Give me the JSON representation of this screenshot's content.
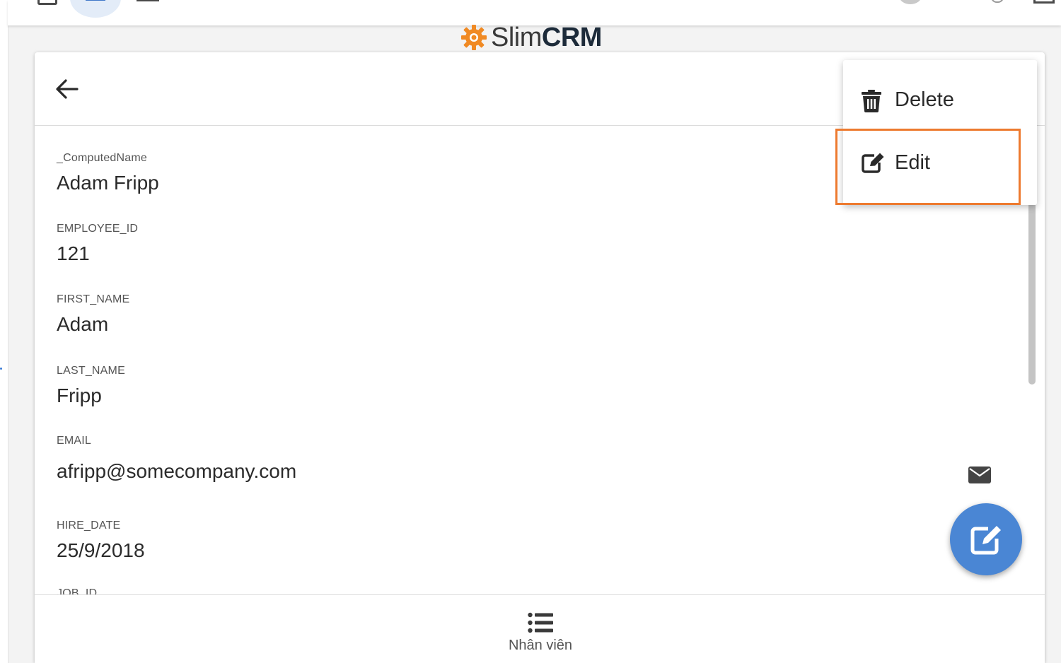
{
  "app": {
    "logo_text_slim": "Slim",
    "logo_text_crm": "CRM",
    "accent_color": "#4a86d4",
    "logo_color": "#f08a24",
    "highlight_color": "#ed7a2f"
  },
  "header": {
    "back_icon": "arrow-left-icon"
  },
  "record": {
    "fields": [
      {
        "label": "_ComputedName",
        "value": "Adam Fripp"
      },
      {
        "label": "EMPLOYEE_ID",
        "value": "121"
      },
      {
        "label": "FIRST_NAME",
        "value": "Adam"
      },
      {
        "label": "LAST_NAME",
        "value": "Fripp"
      },
      {
        "label": "EMAIL",
        "value": "afripp@somecompany.com"
      },
      {
        "label": "HIRE_DATE",
        "value": "25/9/2018"
      },
      {
        "label": "JOB_ID",
        "value": ""
      }
    ]
  },
  "menu": {
    "items": [
      {
        "label": "Delete",
        "icon": "trash-icon"
      },
      {
        "label": "Edit",
        "icon": "edit-icon"
      }
    ]
  },
  "bottom_nav": {
    "label": "Nhân viên",
    "icon": "list-icon"
  },
  "fab": {
    "icon": "edit-icon"
  }
}
